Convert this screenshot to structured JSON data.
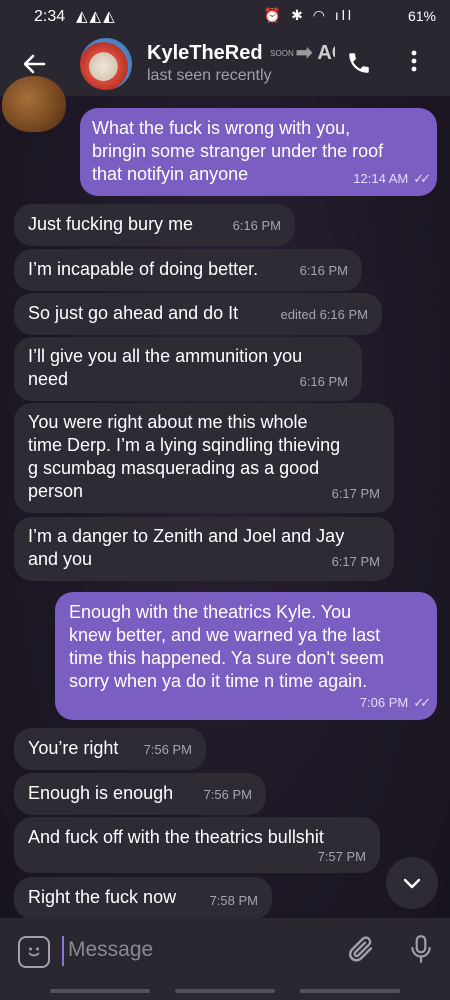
{
  "status_bar": {
    "time": "2:34",
    "left_icons": "◭◭◭",
    "right_icons": "⏰ ✱ ◠ ıll",
    "battery": "61%"
  },
  "header": {
    "back_icon": "arrow-left",
    "title_main": "KyleTheRed",
    "title_soon": "SOON",
    "title_tail": "AC",
    "subtitle": "last seen recently",
    "call_icon": "phone",
    "menu_icon": "more-vertical"
  },
  "messages": [
    {
      "dir": "out",
      "lines": [
        "What the fuck is wrong with you,",
        "bringin some stranger under the roof",
        "that notifyin anyone"
      ],
      "time": "12:14 AM",
      "read": "✓✓"
    },
    {
      "dir": "in",
      "lines": [
        "Just fucking bury me"
      ],
      "time": "6:16 PM"
    },
    {
      "dir": "in",
      "lines": [
        "I’m incapable of doing better."
      ],
      "time": "6:16 PM"
    },
    {
      "dir": "in",
      "lines": [
        "So just go ahead and do It"
      ],
      "time": "edited 6:16 PM"
    },
    {
      "dir": "in",
      "lines": [
        "I’ll give you all the ammunition you",
        "need"
      ],
      "time": "6:16 PM"
    },
    {
      "dir": "in",
      "lines": [
        "You were right about me this whole",
        "time Derp. I’m a lying sqindling thieving",
        "g scumbag masquerading as a good",
        "person"
      ],
      "time": "6:17 PM"
    },
    {
      "dir": "in",
      "lines": [
        "I’m a danger to Zenith and Joel and Jay",
        "and you"
      ],
      "time": "6:17 PM"
    },
    {
      "dir": "out",
      "lines": [
        "Enough with the theatrics Kyle.  You",
        "knew better,  and we warned ya the last",
        "time this happened. Ya sure don't seem",
        "sorry when ya do it time n time again."
      ],
      "time": "7:06 PM",
      "read": "✓✓"
    },
    {
      "dir": "in",
      "lines": [
        "You’re right"
      ],
      "time": "7:56 PM"
    },
    {
      "dir": "in",
      "lines": [
        "Enough is enough"
      ],
      "time": "7:56 PM"
    },
    {
      "dir": "in",
      "lines": [
        "And fuck off with the theatrics bullshit"
      ],
      "time": "7:57 PM"
    },
    {
      "dir": "in",
      "lines": [
        "Right the fuck now"
      ],
      "time": "7:58 PM"
    }
  ],
  "input": {
    "placeholder": "Message"
  },
  "colors": {
    "outgoing_bubble": "#7b5ec2",
    "incoming_bubble": "#2e2b35",
    "bar": "#2a2731"
  }
}
